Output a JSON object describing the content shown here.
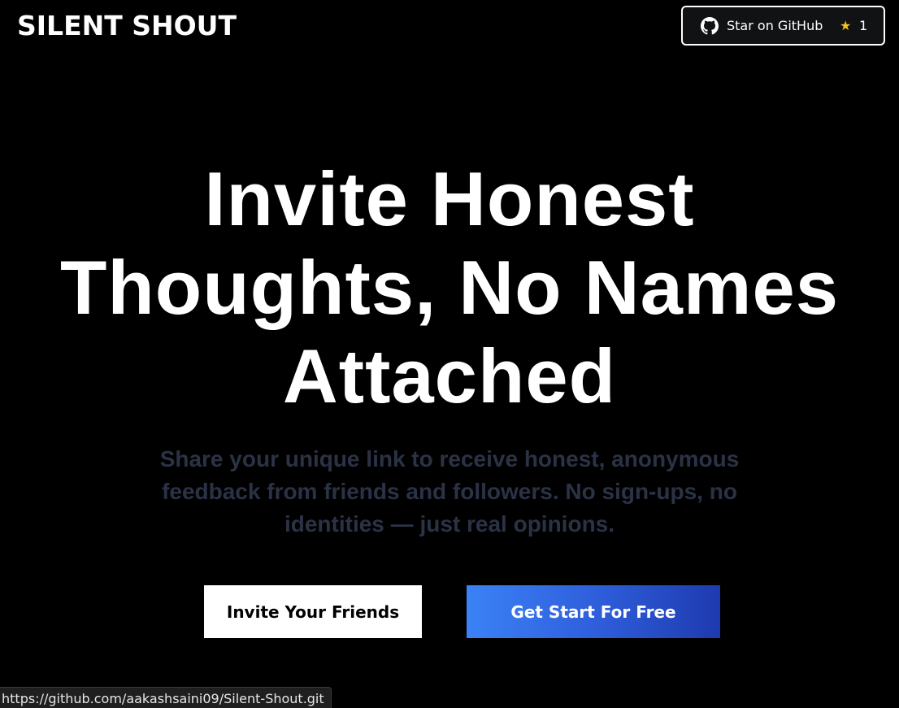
{
  "header": {
    "brand": "SILENT SHOUT",
    "github_button": {
      "label": "Star on GitHub",
      "icon": "github-icon",
      "star_icon": "star-icon",
      "star_count": "1"
    }
  },
  "hero": {
    "title_lines": [
      "Invite Honest",
      "Thoughts, No Names",
      "Attached"
    ],
    "subtitle": "Share your unique link to receive honest, anonymous feedback from friends and followers. No sign-ups, no identities — just real opinions.",
    "primary_button": "Invite Your Friends",
    "secondary_button": "Get Start For Free"
  },
  "status_bar": {
    "url": "https://github.com/aakashsaini09/Silent-Shout.git"
  },
  "colors": {
    "background": "#000000",
    "subtitle": "#2b3245",
    "accent_gradient_start": "#3b82f6",
    "accent_gradient_end": "#1e3aaf",
    "star": "#f5c518"
  }
}
